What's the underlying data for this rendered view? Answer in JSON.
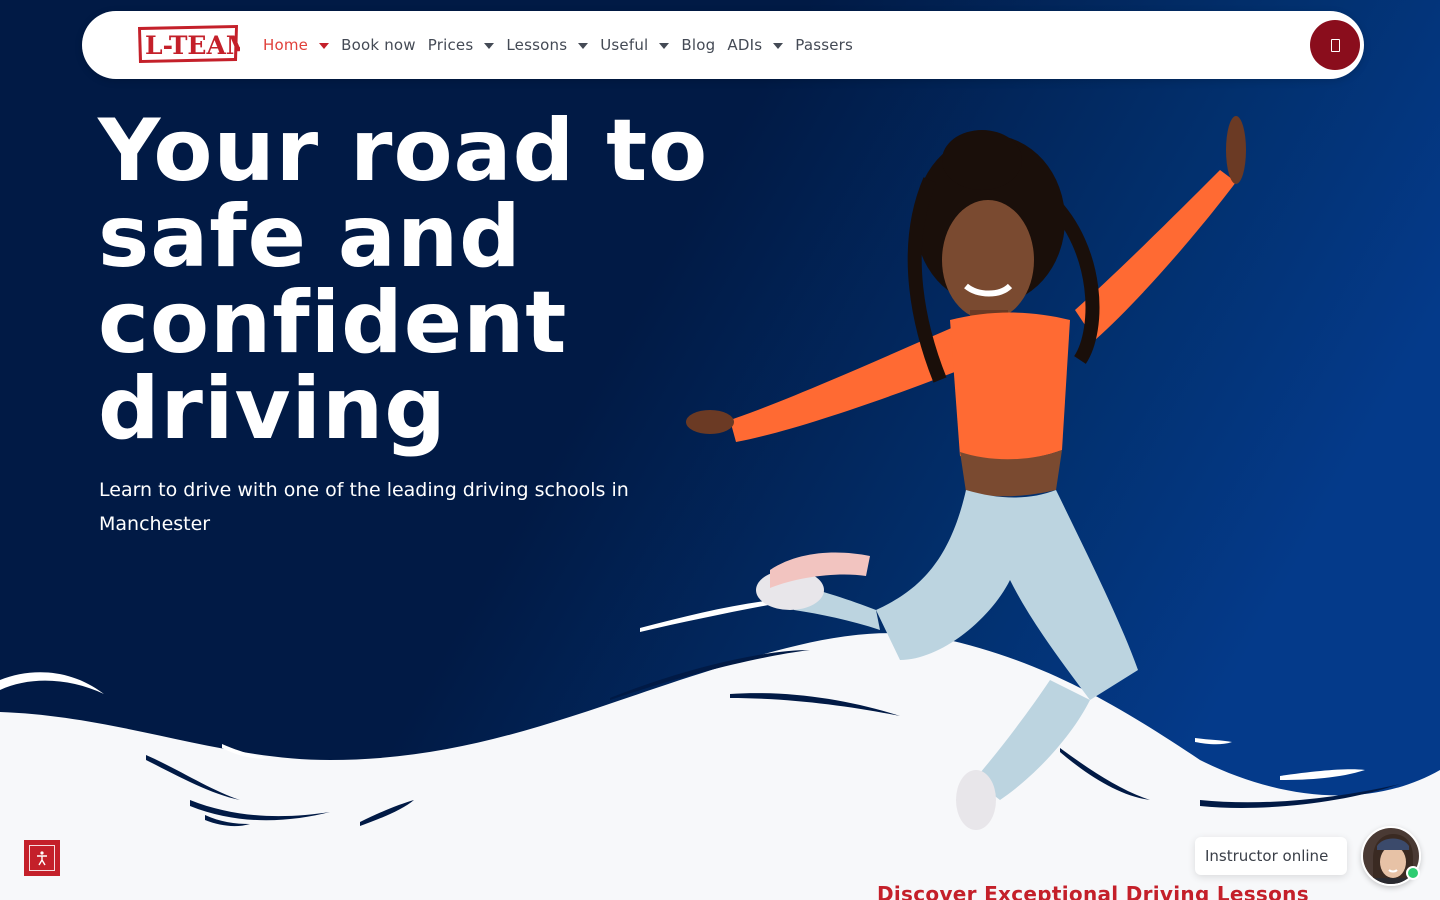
{
  "brand": {
    "logo_text": "L-TEAM",
    "colors": {
      "navy": "#011a45",
      "blue": "#043a8a",
      "red": "#c4202a",
      "dark_red": "#8a0d1c",
      "white": "#ffffff"
    }
  },
  "nav": {
    "items": [
      {
        "label": "Home",
        "has_dropdown": true,
        "active": true
      },
      {
        "label": "Book now",
        "has_dropdown": false,
        "active": false
      },
      {
        "label": "Prices",
        "has_dropdown": true,
        "active": false
      },
      {
        "label": "Lessons",
        "has_dropdown": true,
        "active": false
      },
      {
        "label": "Useful",
        "has_dropdown": true,
        "active": false
      },
      {
        "label": "Blog",
        "has_dropdown": false,
        "active": false
      },
      {
        "label": "ADIs",
        "has_dropdown": true,
        "active": false
      },
      {
        "label": "Passers",
        "has_dropdown": false,
        "active": false
      }
    ],
    "menu_icon": "phone-icon"
  },
  "hero": {
    "title": "Your road to safe and confident driving",
    "subtitle": "Learn to drive with one of the leading driving schools in Manchester"
  },
  "chat": {
    "status_label": "Instructor online",
    "avatar_icon": "instructor-avatar"
  },
  "accessibility": {
    "icon": "accessibility-icon"
  },
  "next_section": {
    "heading": "Discover Exceptional Driving Lessons"
  }
}
